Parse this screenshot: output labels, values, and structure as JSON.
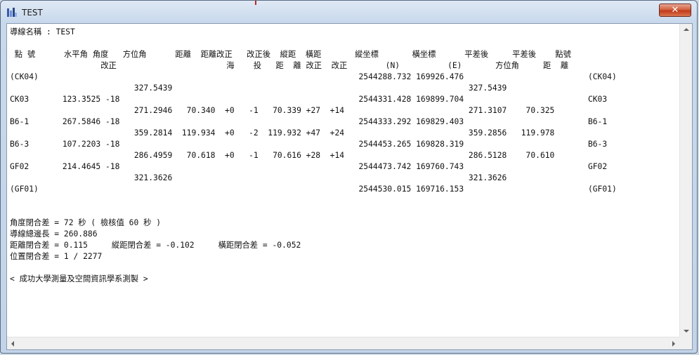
{
  "window": {
    "title": "TEST",
    "close_glyph": "✕",
    "icon": "traverse-app-icon"
  },
  "report": {
    "lines": [
      "導線名稱 : TEST",
      "",
      " 點 號      水平角 角度   方位角      距離  距離改正   改正後  縱距  橫距       縱坐標       橫坐標      平差後     平差後    點號",
      "                   改正                       海    投   距  離 改正  改正        (N)          (E)       方位角     距  離",
      "(CK04)                                                                   2544288.732 169926.476                          (CK04)",
      "                          327.5439                                                              327.5439",
      "CK03       123.3525 -18                                                  2544331.428 169899.704                          CK03",
      "                          271.2946   70.340  +0   -1   70.339 +27  +14                          271.3107    70.325",
      "B6-1       267.5846 -18                                                  2544333.292 169829.403                          B6-1",
      "                          359.2814  119.934  +0   -2  119.932 +47  +24                          359.2856   119.978",
      "B6-3       107.2203 -18                                                  2544453.265 169828.319                          B6-3",
      "                          286.4959   70.618  +0   -1   70.616 +28  +14                          286.5128    70.610",
      "GF02       214.4645 -18                                                  2544473.742 169760.743                          GF02",
      "                          321.3626                                                              321.3626",
      "(GF01)                                                                   2544530.015 169716.153                          (GF01)",
      "",
      "",
      "角度閉合差 = 72 秒 ( 檢核值 60 秒 )",
      "導線總邊長 = 260.886",
      "距離閉合差 = 0.115     縱距閉合差 = -0.102     橫距閉合差 = -0.052",
      "位置閉合差 = 1 / 2277",
      "",
      "< 成功大學測量及空間資訊學系測製 >"
    ]
  }
}
